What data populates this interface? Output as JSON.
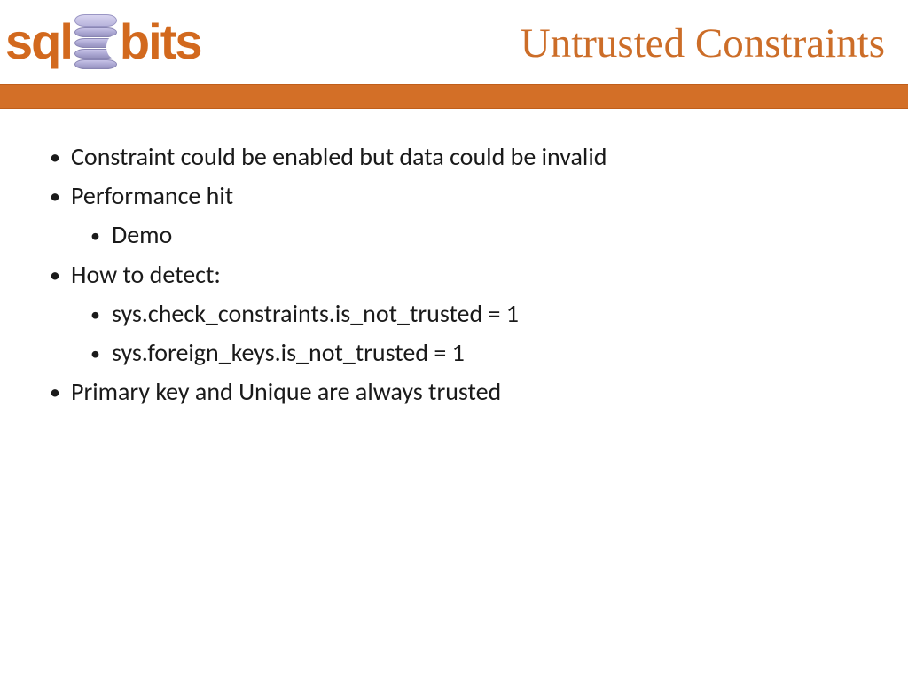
{
  "logo": {
    "left": "sql",
    "right": "bits"
  },
  "title": "Untrusted Constraints",
  "bullets": [
    {
      "text": "Constraint could be enabled but data could be invalid",
      "children": []
    },
    {
      "text": "Performance hit",
      "children": [
        {
          "text": "Demo"
        }
      ]
    },
    {
      "text": "How to detect:",
      "children": [
        {
          "text": "sys.check_constraints.is_not_trusted = 1"
        },
        {
          "text": "sys.foreign_keys.is_not_trusted = 1"
        }
      ]
    },
    {
      "text": "Primary key and Unique are always trusted",
      "children": []
    }
  ]
}
